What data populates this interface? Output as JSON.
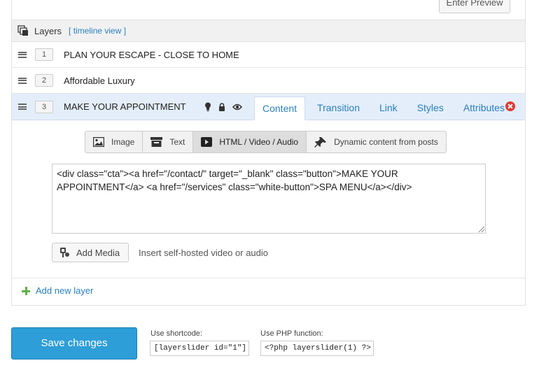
{
  "top": {
    "preview_label": "Enter Preview"
  },
  "panel": {
    "title": "Layers",
    "timeline_link": "[ timeline view ]",
    "layers": [
      {
        "num": "1",
        "name": "PLAN YOUR ESCAPE - CLOSE TO HOME"
      },
      {
        "num": "2",
        "name": "Affordable Luxury"
      },
      {
        "num": "3",
        "name": "MAKE YOUR APPOINTMENT"
      }
    ],
    "tabs": [
      "Content",
      "Transition",
      "Link",
      "Styles",
      "Attributes"
    ],
    "active_tab": "Content",
    "types": [
      "Image",
      "Text",
      "HTML / Video / Audio",
      "Dynamic content from posts"
    ],
    "active_type": "HTML / Video / Audio",
    "html_content": "<div class=\"cta\"><a href=\"/contact/\" target=\"_blank\" class=\"button\">MAKE YOUR APPOINTMENT</a> <a href=\"/services\" class=\"white-button\">SPA MENU</a></div>",
    "add_media_label": "Add Media",
    "media_hint": "Insert self-hosted video or audio",
    "add_layer_label": "Add new layer"
  },
  "footer": {
    "save_label": "Save changes",
    "shortcode_label": "Use shortcode:",
    "shortcode_value": "[layerslider id=\"1\"]",
    "php_label": "Use PHP function:",
    "php_value": "<?php layerslider(1) ?>"
  },
  "colors": {
    "accent": "#2a7fc0",
    "save_button": "#2e9ed8",
    "active_row": "#e4eefa",
    "remove": "#dd3d36",
    "add": "#5fb04a"
  }
}
